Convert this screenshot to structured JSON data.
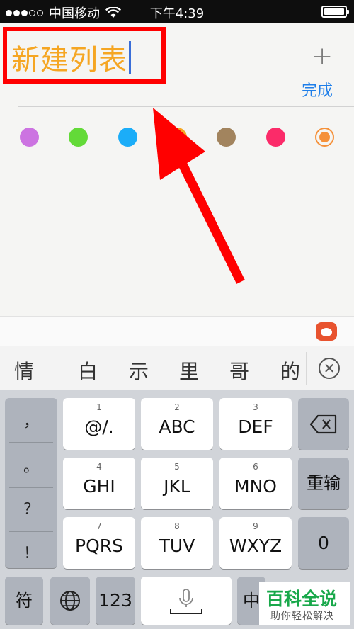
{
  "status_bar": {
    "carrier": "中国移动",
    "time": "下午4:39"
  },
  "header": {
    "title": "新建列表",
    "done_label": "完成",
    "add_icon": "plus-icon"
  },
  "colors": {
    "title": "#f5a623",
    "done": "#1e7ee9",
    "annotation": "#ff0000",
    "swatches": [
      "#cc73e1",
      "#63da38",
      "#1badf8",
      "#f5a623",
      "#a2845e",
      "#fb2b69",
      "#f5913a"
    ]
  },
  "candidates": [
    "情",
    "白",
    "示",
    "里",
    "哥",
    "的"
  ],
  "keyboard": {
    "punctuation": [
      "，",
      "。",
      "？",
      "！"
    ],
    "rows": [
      [
        {
          "num": "1",
          "label": "@/."
        },
        {
          "num": "2",
          "label": "ABC"
        },
        {
          "num": "3",
          "label": "DEF"
        }
      ],
      [
        {
          "num": "4",
          "label": "GHI"
        },
        {
          "num": "5",
          "label": "JKL"
        },
        {
          "num": "6",
          "label": "MNO"
        }
      ],
      [
        {
          "num": "7",
          "label": "PQRS"
        },
        {
          "num": "8",
          "label": "TUV"
        },
        {
          "num": "9",
          "label": "WXYZ"
        }
      ]
    ],
    "reinput": "重输",
    "zero": "0",
    "symbol": "符",
    "numeric": "123",
    "chinese": "中"
  },
  "watermark": {
    "main": "百科全说",
    "sub": "助你轻松解决"
  }
}
